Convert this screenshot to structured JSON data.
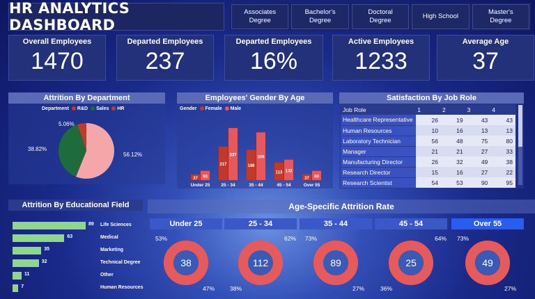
{
  "title": "HR ANALYTICS DASHBOARD",
  "education_slicer": [
    "Associates\nDegree",
    "Bachelor's\nDegree",
    "Doctoral\nDegree",
    "High School",
    "Master's\nDegree"
  ],
  "kpis": [
    {
      "label": "Overall Employees",
      "value": "1470"
    },
    {
      "label": "Departed Employees",
      "value": "237"
    },
    {
      "label": "Departed Employees",
      "value": "16%"
    },
    {
      "label": "Active Employees",
      "value": "1233"
    },
    {
      "label": "Average Age",
      "value": "37"
    }
  ],
  "attrition_dept": {
    "title": "Attrition By Department",
    "legend_title": "Department",
    "legend": [
      "R&D",
      "Sales",
      "HR"
    ],
    "labels": {
      "rd": "56.12%",
      "sales": "38.82%",
      "hr": "5.06%"
    }
  },
  "gender_age": {
    "title": "Employees' Gender By Age",
    "legend_title": "Gender",
    "legend": [
      "Female",
      "Male"
    ]
  },
  "satisfaction": {
    "title": "Satisfaction By Job Role",
    "header": [
      "Job Role",
      "1",
      "2",
      "3",
      "4"
    ],
    "rows": [
      [
        "Healthcare Representative",
        "26",
        "19",
        "43",
        "43"
      ],
      [
        "Human Resources",
        "10",
        "16",
        "13",
        "13"
      ],
      [
        "Laboratory Technician",
        "56",
        "48",
        "75",
        "80"
      ],
      [
        "Manager",
        "21",
        "21",
        "27",
        "33"
      ],
      [
        "Manufacturing Director",
        "26",
        "32",
        "49",
        "38"
      ],
      [
        "Research Director",
        "15",
        "16",
        "27",
        "22"
      ],
      [
        "Research Scientist",
        "54",
        "53",
        "90",
        "95"
      ]
    ]
  },
  "education_field": {
    "title": "Attrition By Educational Field"
  },
  "age_attrition": {
    "title": "Age-Specific Attrition Rate",
    "groups": [
      {
        "label": "Under 25",
        "center": "38",
        "top": "53%",
        "bottom": "47%"
      },
      {
        "label": "25 - 34",
        "center": "112",
        "top": "62%",
        "bottom": "38%"
      },
      {
        "label": "35 - 44",
        "center": "89",
        "top": "73%",
        "bottom": "27%"
      },
      {
        "label": "45 - 54",
        "center": "25",
        "top": "64%",
        "bottom": "36%"
      },
      {
        "label": "Over 55",
        "center": "49",
        "top": "73%",
        "bottom": "27%"
      }
    ]
  },
  "colors": {
    "rd": "#f4a6a8",
    "sales": "#1e6b3c",
    "hr": "#c0392b",
    "female": "#c0392b",
    "male": "#e8585a",
    "bar": "#8fd88a",
    "ring": "#e85a5a"
  },
  "chart_data": [
    {
      "type": "pie",
      "title": "Attrition By Department",
      "categories": [
        "R&D",
        "Sales",
        "HR"
      ],
      "values": [
        56.12,
        38.82,
        5.06
      ]
    },
    {
      "type": "bar",
      "title": "Employees' Gender By Age",
      "categories": [
        "Under 25",
        "25 - 34",
        "35 - 44",
        "45 - 54",
        "Over 55"
      ],
      "series": [
        {
          "name": "Female",
          "values": [
            37,
            217,
            196,
            113,
            37
          ]
        },
        {
          "name": "Male",
          "values": [
            60,
            337,
            309,
            132,
            60
          ]
        }
      ]
    },
    {
      "type": "bar",
      "title": "Attrition By Educational Field",
      "categories": [
        "Life Sciences",
        "Medical",
        "Marketing",
        "Technical Degree",
        "Other",
        "Human Resources"
      ],
      "values": [
        89,
        63,
        35,
        32,
        11,
        7
      ]
    }
  ]
}
